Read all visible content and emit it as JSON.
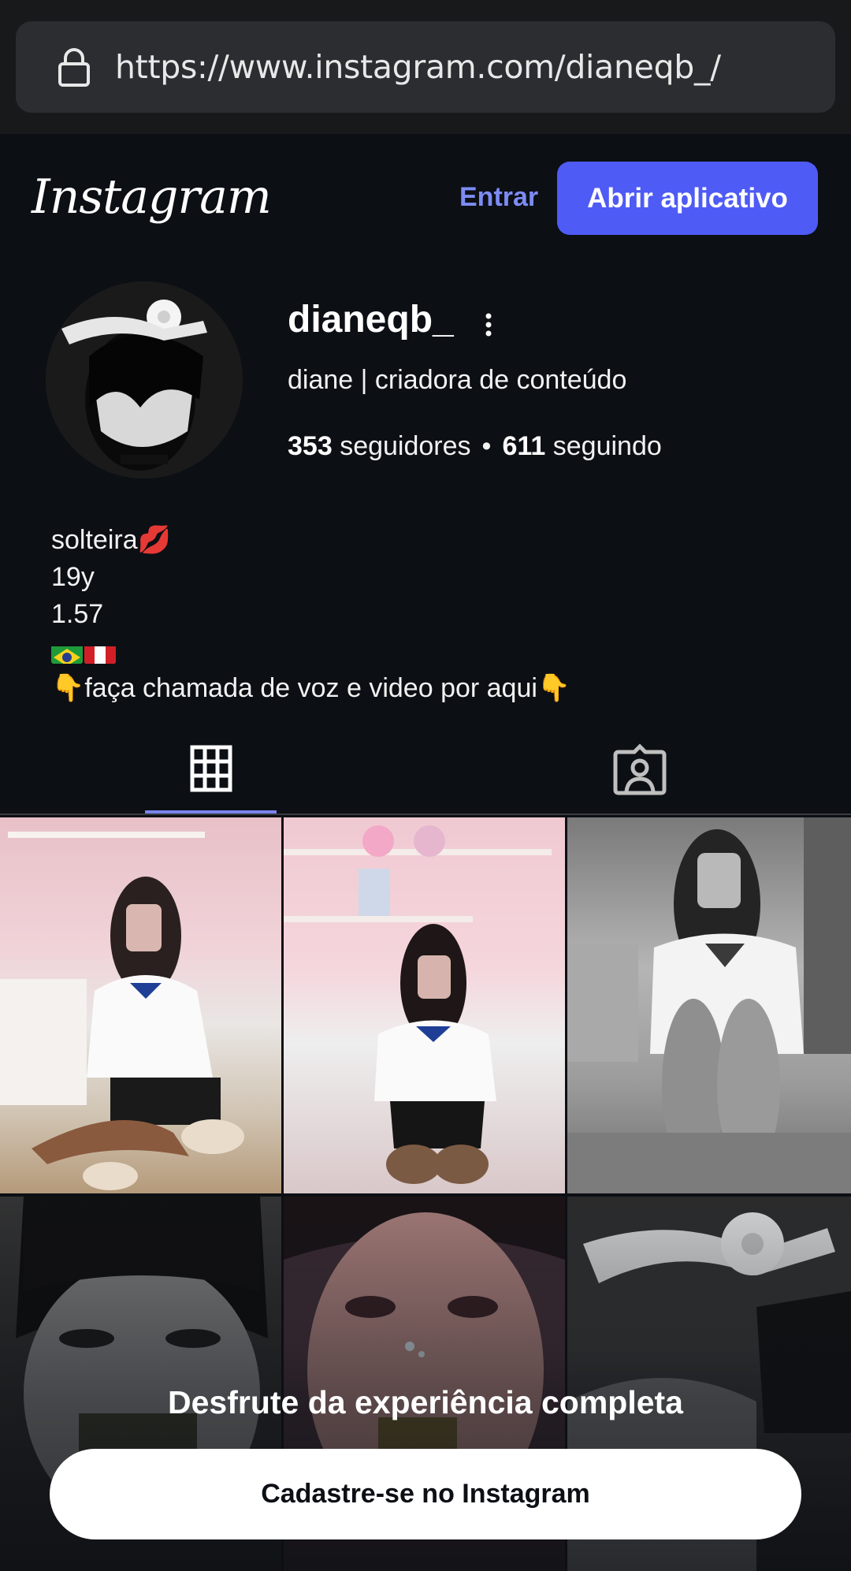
{
  "browser": {
    "url": "https://www.instagram.com/dianeqb_/",
    "lock_icon": "lock-icon"
  },
  "header": {
    "logo": "Instagram",
    "login_label": "Entrar",
    "open_app_label": "Abrir aplicativo"
  },
  "profile": {
    "username": "dianeqb_",
    "full_name": "diane | criadora de conteúdo",
    "followers_count": "353",
    "followers_label": "seguidores",
    "separator": "•",
    "following_count": "611",
    "following_label": "seguindo",
    "bio": {
      "line1": "solteira💋",
      "line2": "19y",
      "line3": "1.57",
      "line5": "👇faça chamada de voz e video por aqui👇"
    },
    "flags": [
      "brazil-flag",
      "peru-flag"
    ]
  },
  "tabs": [
    {
      "name": "posts",
      "icon": "grid-icon",
      "active": true
    },
    {
      "name": "tagged",
      "icon": "tagged-user-icon",
      "active": false
    }
  ],
  "posts": [
    {
      "id": 1,
      "tone": "pink room, white jersey"
    },
    {
      "id": 2,
      "tone": "pink room, chair"
    },
    {
      "id": 3,
      "tone": "grayscale"
    },
    {
      "id": 4,
      "tone": "dark grayscale closeup"
    },
    {
      "id": 5,
      "tone": "dark pink closeup"
    },
    {
      "id": 6,
      "tone": "grayscale flower"
    }
  ],
  "promo": {
    "title": "Desfrute da experiência completa",
    "signup_label": "Cadastre-se no Instagram"
  },
  "colors": {
    "background": "#0c0f14",
    "accent": "#4f5bf5",
    "link": "#7d8cf4"
  }
}
